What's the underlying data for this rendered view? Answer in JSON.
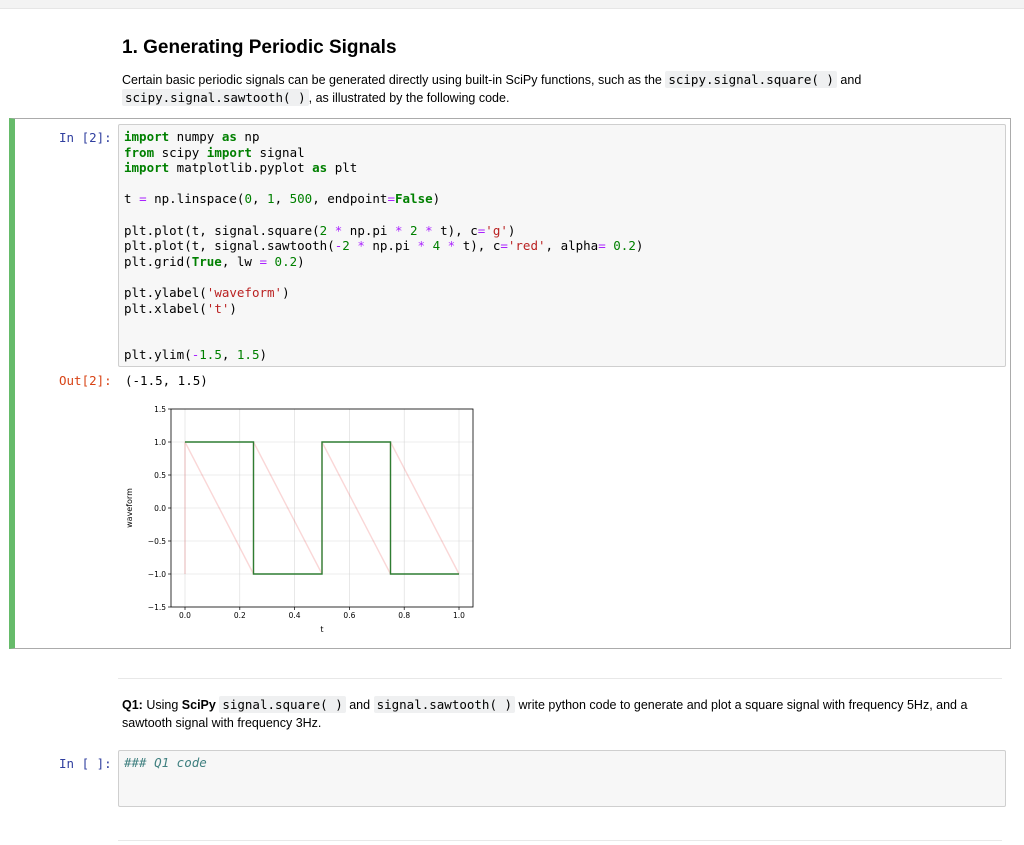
{
  "title": "1. Generating Periodic Signals",
  "intro": {
    "text1": "Certain basic periodic signals can be generated directly using built-in SciPy functions, such as the",
    "code1": "scipy.signal.square( )",
    "text2": "and",
    "code2": "scipy.signal.sawtooth( )",
    "text3": ", as illustrated by the following code."
  },
  "cell1": {
    "in_prompt": "In [2]:",
    "out_prompt": "Out[2]:",
    "output_text": "(-1.5, 1.5)"
  },
  "q1": {
    "label": "Q1:",
    "text1": "Using",
    "bold": "SciPy",
    "code1": "signal.square( )",
    "text2": "and",
    "code2": "signal.sawtooth( )",
    "text3": "write python code to generate and plot a square signal with frequency 5Hz, and a sawtooth signal with frequency 3Hz."
  },
  "cell2": {
    "in_prompt": "In [ ]:",
    "code": "### Q1 code"
  },
  "chart_data": {
    "type": "line",
    "xlabel": "t",
    "ylabel": "waveform",
    "xlim": [
      0,
      1
    ],
    "ylim": [
      -1.5,
      1.5
    ],
    "xticks": [
      "0.0",
      "0.2",
      "0.4",
      "0.6",
      "0.8",
      "1.0"
    ],
    "yticks": [
      "1.5",
      "1.0",
      "0.5",
      "0.0",
      "−0.5",
      "−1.0",
      "−1.5"
    ],
    "grid": true,
    "series": [
      {
        "color": "#2e7d32",
        "alpha": 1.0,
        "x": [
          0,
          0.25,
          0.25,
          0.5,
          0.5,
          0.75,
          0.75,
          1.0
        ],
        "y": [
          1,
          1,
          -1,
          -1,
          1,
          1,
          -1,
          -1
        ]
      },
      {
        "color": "#e53935",
        "alpha": 0.2,
        "x": [
          0,
          0,
          0.25,
          0.25,
          0.5,
          0.5,
          0.75,
          0.75,
          1.0
        ],
        "y": [
          -1,
          1,
          -1,
          1,
          -1,
          1,
          -1,
          1,
          -1
        ]
      }
    ]
  }
}
